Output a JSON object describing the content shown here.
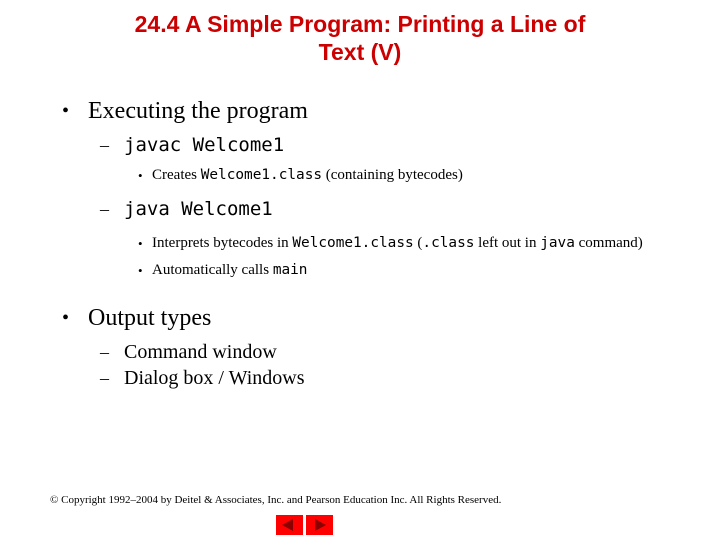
{
  "slide": {
    "title_line1": "24.4  A Simple Program: Printing a Line of",
    "title_line2": "Text (V)",
    "title_color": "#CC0000",
    "background_color": "#FFFFFF"
  },
  "bullets": {
    "b1": {
      "marker": "•",
      "text": "Executing the program"
    },
    "b1_s1": {
      "marker": "–",
      "text": "javac Welcome1"
    },
    "b1_s1_c1": {
      "marker": "•",
      "part1": "Creates ",
      "code1": "Welcome1.class",
      "part2": " (containing bytecodes)"
    },
    "b1_s2": {
      "marker": "–",
      "text": "java Welcome1"
    },
    "b1_s2_c1": {
      "marker": "•",
      "part1": "Interprets bytecodes in ",
      "code1": "Welcome1.class",
      "part2": " (",
      "code2": ".class",
      "part3": " left out in ",
      "code3": "java",
      "part4": " command)"
    },
    "b1_s2_c2": {
      "marker": "•",
      "part1": "Automatically calls ",
      "code1": "main"
    },
    "b2": {
      "marker": "•",
      "text": "Output types"
    },
    "b2_s1": {
      "marker": "–",
      "text": "Command window"
    },
    "b2_s2": {
      "marker": "–",
      "text": "Dialog box / Windows"
    }
  },
  "footer": {
    "copyright": "© Copyright 1992–2004 by Deitel & Associates, Inc. and Pearson Education Inc. All Rights Reserved.",
    "prev_label": "◀",
    "next_label": "▶",
    "button_color": "#FF0000",
    "arrow_color": "#8B0000"
  }
}
